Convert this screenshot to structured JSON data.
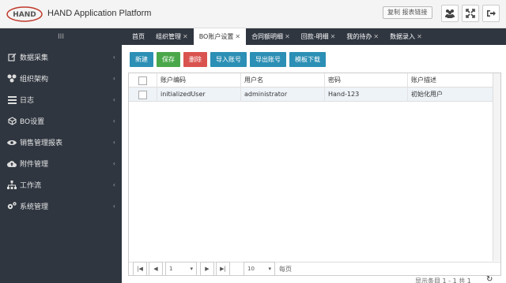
{
  "header": {
    "logo_text": "HAND",
    "app_title": "HAND Application Platform",
    "copy_button": "复制 报表链接",
    "icons": [
      "users-icon",
      "fullscreen-icon",
      "logout-icon"
    ]
  },
  "sidebar_toggle": "III",
  "tabs": [
    {
      "label": "首页",
      "closable": false,
      "active": false
    },
    {
      "label": "组织管理",
      "closable": true,
      "active": false
    },
    {
      "label": "BO账户设置",
      "closable": true,
      "active": true
    },
    {
      "label": "合同额明细",
      "closable": true,
      "active": false
    },
    {
      "label": "回款-明细",
      "closable": true,
      "active": false
    },
    {
      "label": "我的待办",
      "closable": true,
      "active": false
    },
    {
      "label": "数据录入",
      "closable": true,
      "active": false
    }
  ],
  "sidebar": {
    "items": [
      {
        "label": "数据采集",
        "icon": "edit-icon"
      },
      {
        "label": "组织架构",
        "icon": "sitemap-icon"
      },
      {
        "label": "日志",
        "icon": "list-icon"
      },
      {
        "label": "BO设置",
        "icon": "cube-icon"
      },
      {
        "label": "销售管理报表",
        "icon": "eye-icon"
      },
      {
        "label": "附件管理",
        "icon": "cloud-upload-icon"
      },
      {
        "label": "工作流",
        "icon": "flow-icon"
      },
      {
        "label": "系统管理",
        "icon": "cogs-icon"
      }
    ]
  },
  "toolbar": {
    "new": "新建",
    "save": "保存",
    "delete": "删除",
    "import": "导入账号",
    "export": "导出账号",
    "template": "模板下载"
  },
  "grid": {
    "columns": [
      "账户编码",
      "用户名",
      "密码",
      "账户描述"
    ],
    "rows": [
      [
        "initializedUser",
        "administrator",
        "Hand-123",
        "初始化用户"
      ]
    ]
  },
  "pager": {
    "page": "1",
    "page_size": "10",
    "per_page_label": "每页",
    "summary": "显示条目 1 - 1 共 1"
  },
  "colors": {
    "sidebar_bg": "#2f3640",
    "button_blue": "#2c8fb5",
    "button_green": "#4aa84a",
    "button_red": "#d9534f"
  }
}
